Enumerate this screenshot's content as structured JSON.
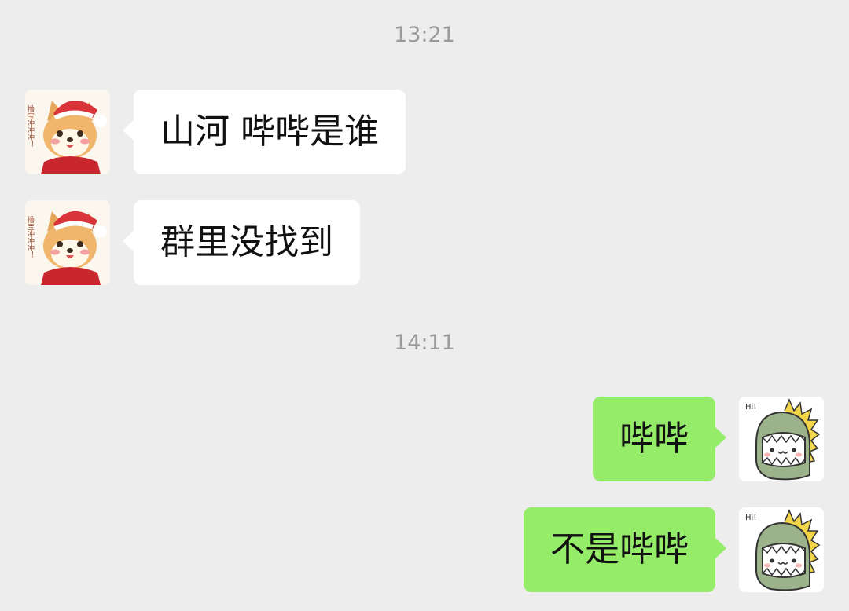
{
  "chat": {
    "messages": [
      {
        "type": "timestamp",
        "text": "13:21"
      },
      {
        "type": "incoming",
        "text": "山河 哔哔是谁",
        "avatar_icon": "shiba-dog-avatar-icon"
      },
      {
        "type": "incoming",
        "text": "群里没找到",
        "avatar_icon": "shiba-dog-avatar-icon"
      },
      {
        "type": "timestamp",
        "text": "14:11"
      },
      {
        "type": "outgoing",
        "text": "哔哔",
        "avatar_icon": "dinosaur-hi-avatar-icon"
      },
      {
        "type": "outgoing",
        "text": "不是哔哔",
        "avatar_icon": "dinosaur-hi-avatar-icon"
      }
    ]
  },
  "avatars": {
    "shiba_caption": "撸宝冲冲冲！",
    "dino_caption": "Hi!"
  },
  "colors": {
    "background": "#ededed",
    "incoming_bubble": "#ffffff",
    "outgoing_bubble": "#95ec69",
    "timestamp_text": "#9a9a9a"
  }
}
